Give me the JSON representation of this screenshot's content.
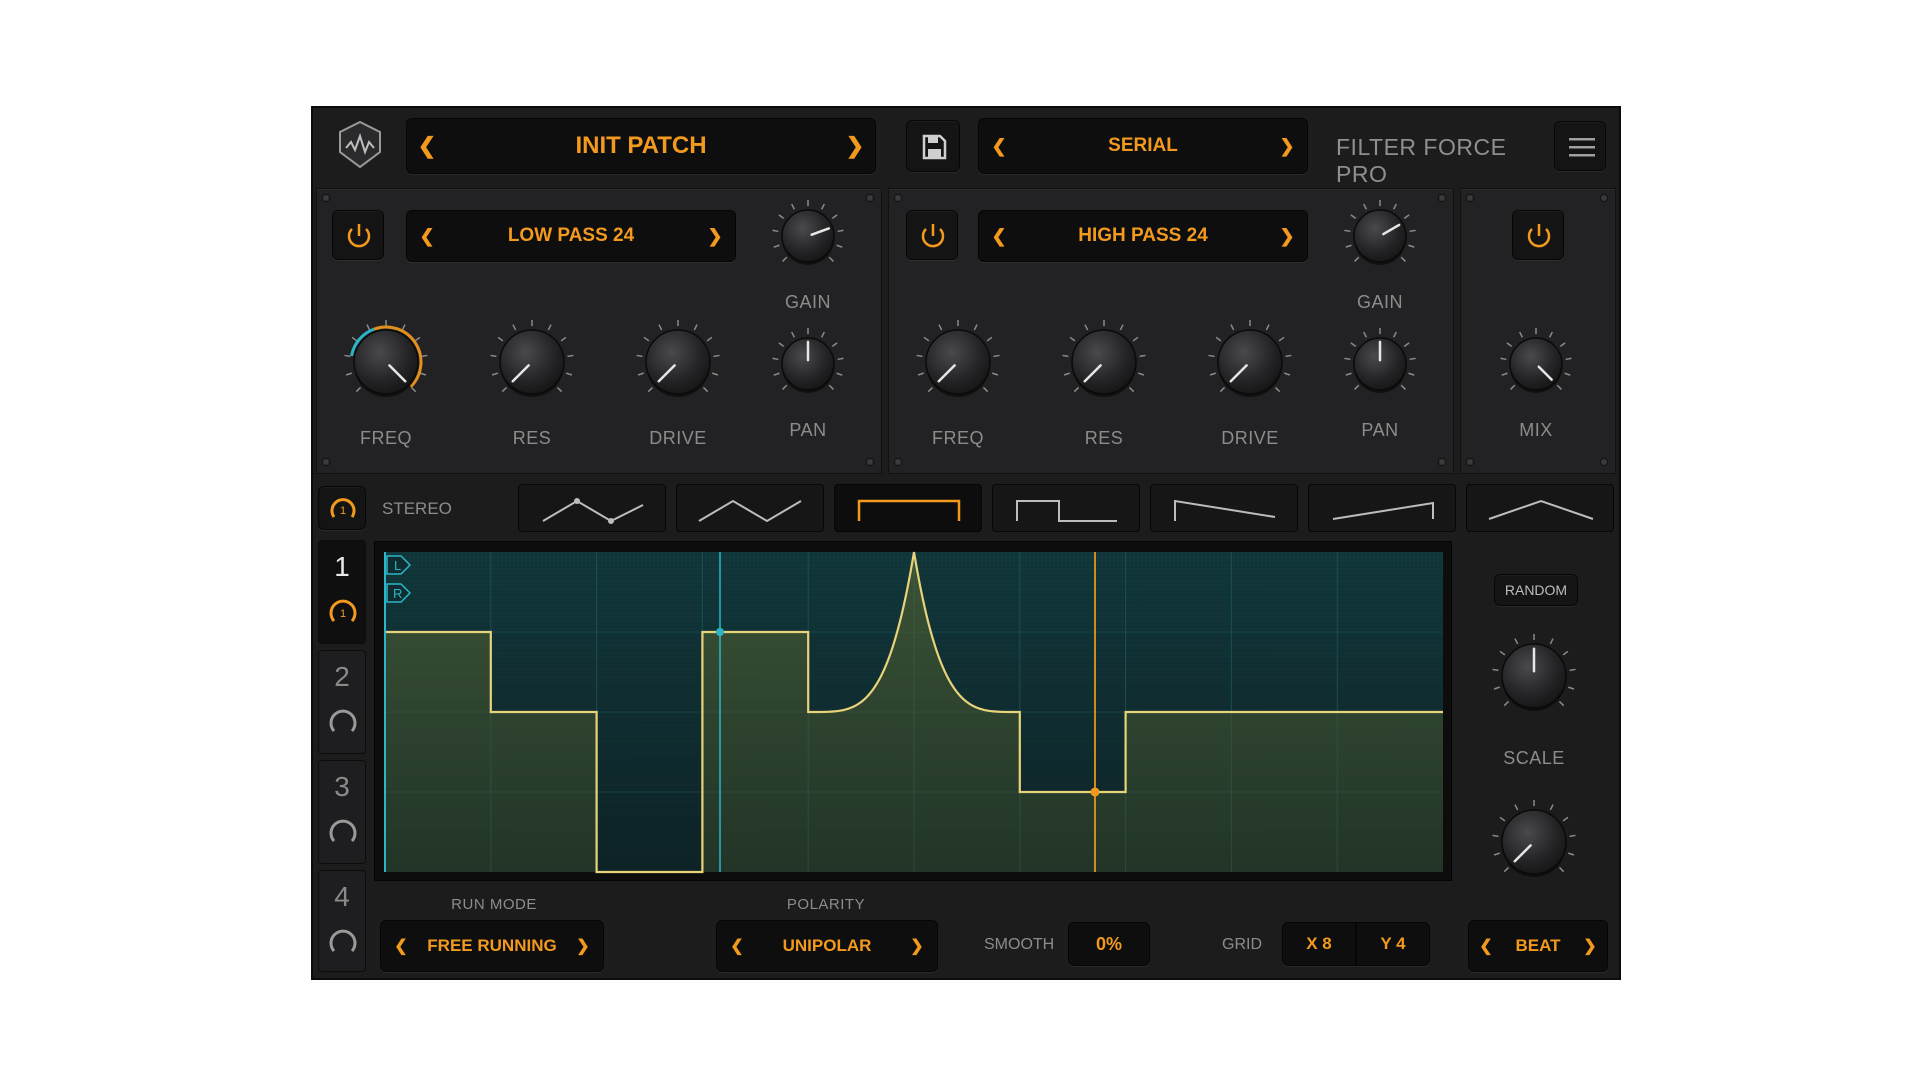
{
  "header": {
    "preset_name": "INIT PATCH",
    "routing": "SERIAL",
    "product_name": "FILTER FORCE PRO"
  },
  "filter1": {
    "type": "LOW PASS 24",
    "gain_label": "GAIN",
    "pan_label": "PAN",
    "freq_label": "FREQ",
    "res_label": "RES",
    "drive_label": "DRIVE"
  },
  "filter2": {
    "type": "HIGH PASS 24",
    "gain_label": "GAIN",
    "pan_label": "PAN",
    "freq_label": "FREQ",
    "res_label": "RES",
    "drive_label": "DRIVE"
  },
  "mix": {
    "label": "MIX"
  },
  "modulator": {
    "stereo_label": "STEREO",
    "tabs": [
      "1",
      "2",
      "3",
      "4"
    ],
    "active_tab": "1",
    "active_tab_badge": "1",
    "shape_presets": [
      "triangle-points",
      "triangle",
      "square-pulse",
      "step",
      "ramp-down",
      "ramp-up",
      "peak"
    ],
    "active_shape": "square-pulse",
    "graph_channels": [
      "L",
      "R"
    ],
    "random_label": "RANDOM",
    "scale_label": "SCALE",
    "run_mode_label": "RUN MODE",
    "run_mode": "FREE RUNNING",
    "polarity_label": "POLARITY",
    "polarity": "UNIPOLAR",
    "smooth_label": "SMOOTH",
    "smooth_value": "0%",
    "grid_label": "GRID",
    "grid_x": "X 8",
    "grid_y": "Y 4",
    "sync": "BEAT"
  },
  "colors": {
    "accent": "#f39a1e",
    "curve": "#e8d27a",
    "cyan": "#2bb6c8",
    "panel": "#222224"
  }
}
